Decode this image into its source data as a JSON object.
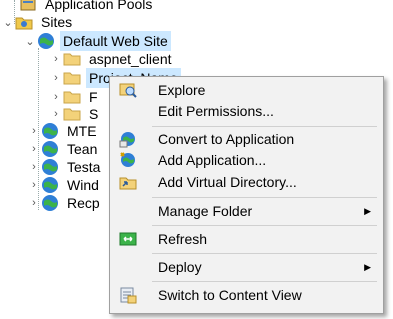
{
  "tree": {
    "app_pools": "Application Pools",
    "sites": "Sites",
    "default_site": "Default Web Site",
    "children": [
      "aspnet_client",
      "Project_Name",
      "F",
      "S"
    ],
    "other_sites": [
      "MTE",
      "Tean",
      "Testa",
      "Wind",
      "Recp"
    ]
  },
  "menu": {
    "items": [
      {
        "label": "Explore",
        "icon": "explore-icon"
      },
      {
        "label": "Edit Permissions...",
        "icon": ""
      },
      {
        "label": "Convert to Application",
        "icon": "convert-app-icon"
      },
      {
        "label": "Add Application...",
        "icon": "add-app-icon"
      },
      {
        "label": "Add Virtual Directory...",
        "icon": "virtual-dir-icon"
      },
      {
        "label": "Manage Folder",
        "icon": "",
        "submenu": true
      },
      {
        "label": "Refresh",
        "icon": "refresh-icon"
      },
      {
        "label": "Deploy",
        "icon": "",
        "submenu": true
      },
      {
        "label": "Switch to Content View",
        "icon": "content-view-icon"
      }
    ],
    "submenu_glyph": "▶"
  },
  "colors": {
    "selection": "#cce8ff",
    "menu_bg": "#f2f2f2"
  }
}
